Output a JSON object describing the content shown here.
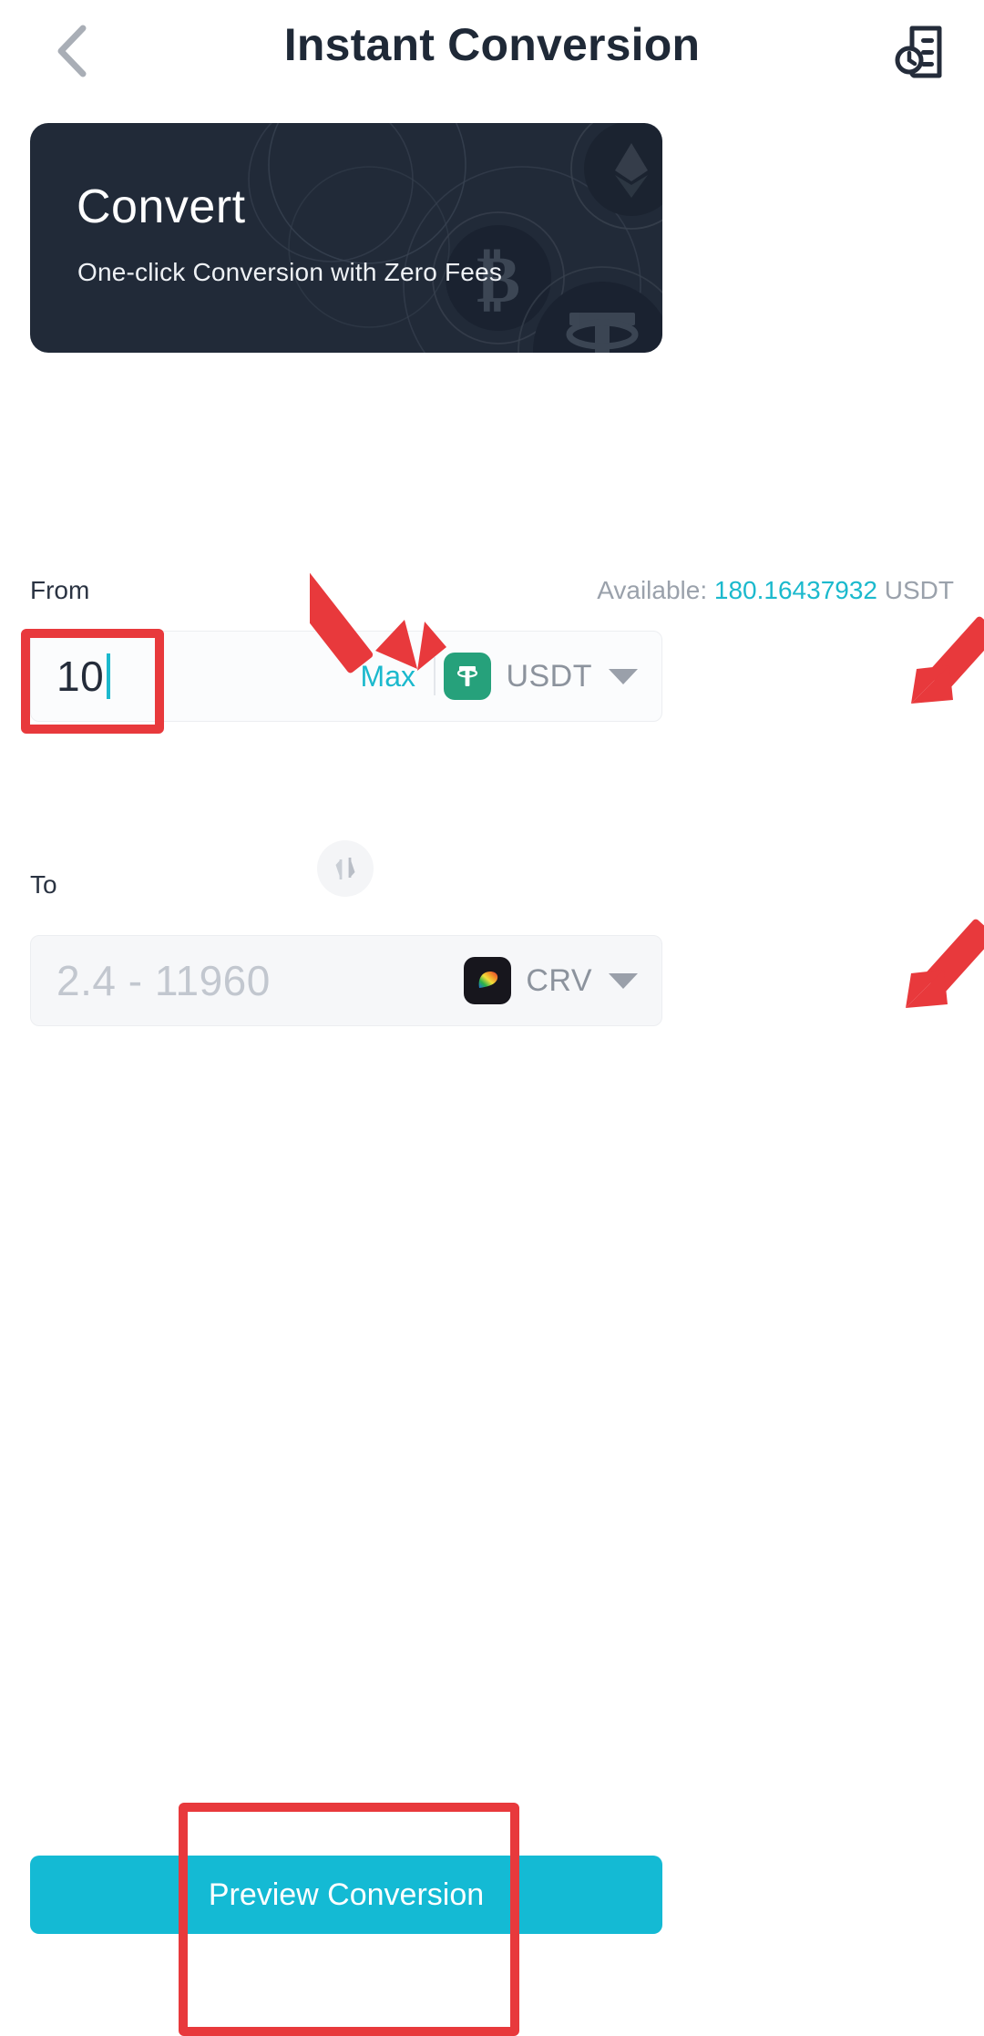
{
  "header": {
    "back_icon": "chevron-left-icon",
    "title": "Instant Conversion",
    "history_icon": "order-history-icon"
  },
  "banner": {
    "title": "Convert",
    "subtitle": "One-click Conversion with Zero Fees",
    "background_color": "#212a38",
    "decorations": [
      "ethereum-coin",
      "bitcoin-coin",
      "tether-coin"
    ]
  },
  "from": {
    "label": "From",
    "available_prefix": "Available:",
    "available_amount": "180.16437932",
    "available_currency": "USDT",
    "amount_value": "10",
    "max_label": "Max",
    "token_symbol": "USDT",
    "token_icon": "tether-icon",
    "token_icon_color": "#26a17b",
    "dropdown_icon": "caret-down-icon"
  },
  "swap": {
    "icon": "swap-vertical-icon"
  },
  "to": {
    "label": "To",
    "amount_placeholder": "2.4 - 11960",
    "token_symbol": "CRV",
    "token_icon": "curve-icon",
    "token_icon_color": "#17161d",
    "dropdown_icon": "caret-down-icon"
  },
  "footer": {
    "preview_label": "Preview Conversion",
    "accent_color": "#14bad4"
  },
  "annotations": {
    "highlight_color": "#e8393c",
    "boxes": [
      "amount-input",
      "preview-conversion-button"
    ],
    "arrows": [
      "available-balance",
      "max-button",
      "from-token-dropdown",
      "to-token-dropdown"
    ]
  }
}
